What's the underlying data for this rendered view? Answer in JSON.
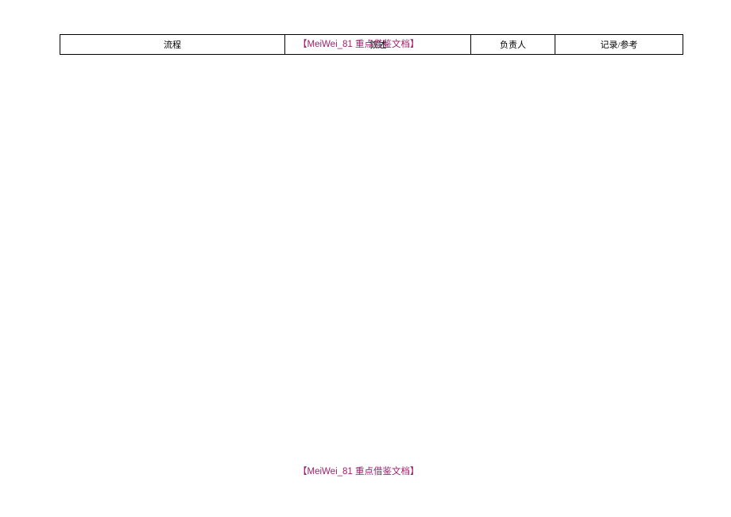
{
  "table": {
    "headers": {
      "flow": "流程",
      "desc": "叙述",
      "owner": "负责人",
      "record": "记录/参考"
    }
  },
  "watermark": {
    "bracket_open": "【",
    "latin": "MeiWei_81 ",
    "cn": "重点借鉴文档",
    "bracket_close": "】"
  }
}
